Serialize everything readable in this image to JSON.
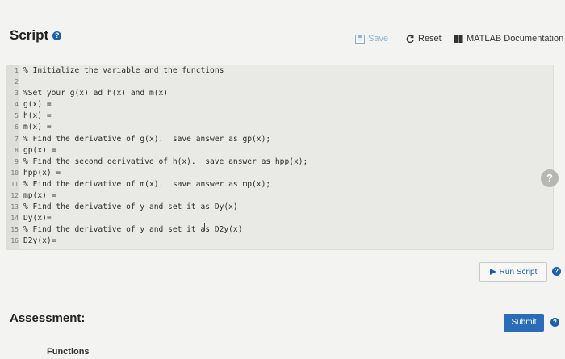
{
  "header": {
    "title": "Script",
    "help_glyph": "?",
    "save_label": "Save",
    "reset_label": "Reset",
    "doc_label": "MATLAB Documentation"
  },
  "editor": {
    "lines": [
      {
        "num": "1",
        "text": "% Initialize the variable and the functions"
      },
      {
        "num": "2",
        "text": ""
      },
      {
        "num": "3",
        "text": "%Set your g(x) ad h(x) and m(x)"
      },
      {
        "num": "4",
        "text": "g(x) ="
      },
      {
        "num": "5",
        "text": "h(x) ="
      },
      {
        "num": "6",
        "text": "m(x) ="
      },
      {
        "num": "7",
        "text": "% Find the derivative of g(x).  save answer as gp(x);"
      },
      {
        "num": "8",
        "text": "gp(x) ="
      },
      {
        "num": "9",
        "text": "% Find the second derivative of h(x).  save answer as hpp(x);"
      },
      {
        "num": "10",
        "text": "hpp(x) ="
      },
      {
        "num": "11",
        "text": "% Find the derivative of m(x).  save answer as mp(x);"
      },
      {
        "num": "12",
        "text": "mp(x) ="
      },
      {
        "num": "13",
        "text": "% Find the derivative of y and set it as Dy(x)"
      },
      {
        "num": "14",
        "text": "Dy(x)="
      },
      {
        "num": "15",
        "text": "% Find the derivative of y and set it as D2y(x)"
      },
      {
        "num": "16",
        "text": "D2y(x)="
      }
    ]
  },
  "help_bubble": "?",
  "run_label": "Run Script",
  "assessment_title": "Assessment:",
  "submit_label": "Submit",
  "functions_label": "Functions",
  "colors": {
    "accent": "#1a5fa8",
    "submit_bg": "#2a6cb8",
    "editor_bg": "#e9eae6"
  }
}
